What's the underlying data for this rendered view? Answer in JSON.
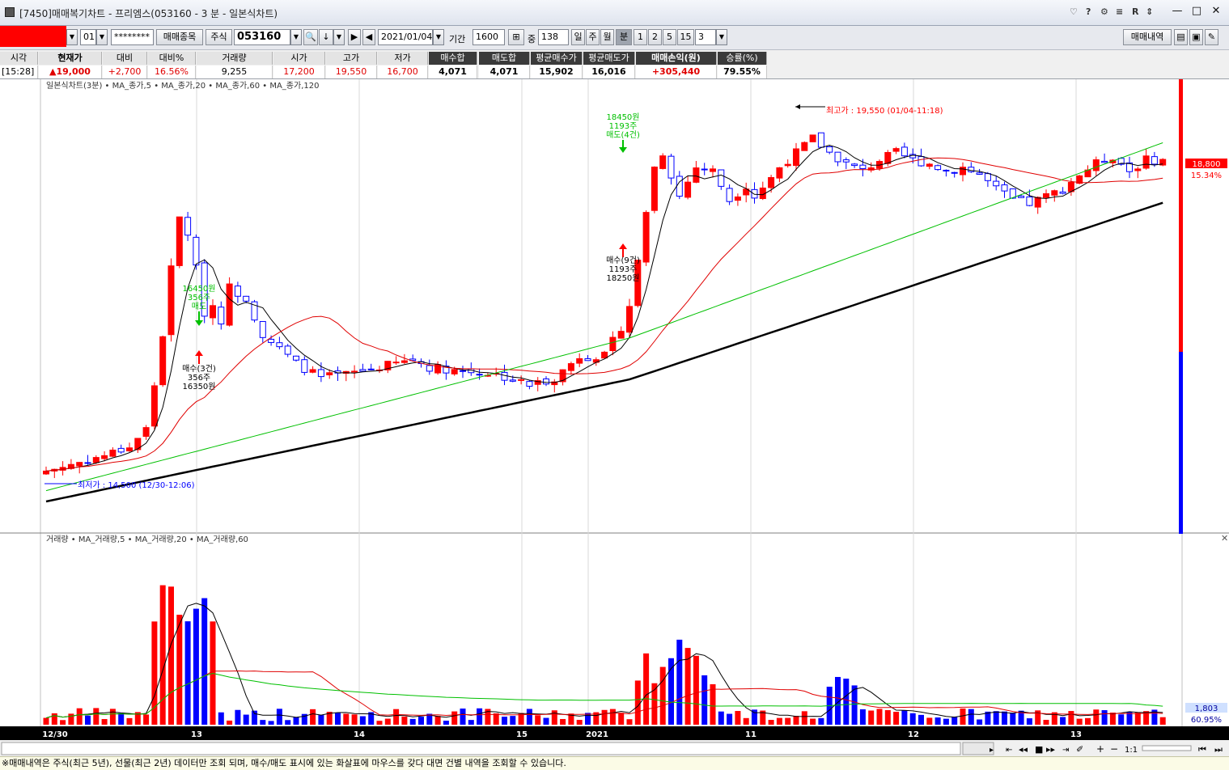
{
  "window": {
    "title": "[7450]매매복기차트 - 프리엠스(053160 - 3 분 - 일본식차트)",
    "controls": [
      "?",
      "R"
    ]
  },
  "toolbar": {
    "account_suffix": "01",
    "password_mask": "********",
    "trade_item_button": "매매종목",
    "market_label": "주식",
    "stock_code": "053160",
    "date": "2021/01/04",
    "period_label": "기간",
    "period_value": "1600",
    "middle_label": "중",
    "middle_value": "138",
    "timeframes": [
      "일",
      "주",
      "월",
      "분",
      "1",
      "2",
      "5",
      "15",
      "3"
    ],
    "selected_timeframe": "분",
    "trade_history_button": "매매내역"
  },
  "info_table": {
    "headers": [
      "시각",
      "현재가",
      "대비",
      "대비%",
      "거래량",
      "시가",
      "고가",
      "저가",
      "매수합",
      "매도합",
      "평균매수가",
      "평균매도가",
      "매매손익(원)",
      "승률(%)"
    ],
    "values": [
      "[15:28]",
      "▲19,000",
      "+2,700",
      "16.56%",
      "9,255",
      "17,200",
      "19,550",
      "16,700",
      "4,071",
      "4,071",
      "15,902",
      "16,016",
      "+305,440",
      "79.55%"
    ]
  },
  "chart_data": {
    "type": "candlestick",
    "price_legend": [
      "일본식차트(3분)",
      "MA_종가,5",
      "MA_종가,20",
      "MA_종가,60",
      "MA_종가,120"
    ],
    "volume_legend": [
      "거래량",
      "MA_거래량,5",
      "MA_거래량,20",
      "MA_거래량,60"
    ],
    "x_labels": [
      "12/30",
      "13",
      "14",
      "15",
      "2021",
      "11",
      "12",
      "13"
    ],
    "annotations": {
      "high": "최고가 : 19,550 (01/04-11:18)",
      "low": "최저가 : 14,500 (12/30-12:06)",
      "sell1": [
        "16450원",
        "356주",
        "매도"
      ],
      "buy1": [
        "매수(3건)",
        "356주",
        "16350원"
      ],
      "sell2": [
        "18450원",
        "1193주",
        "매도(4건)"
      ],
      "buy2": [
        "매수(9건)",
        "1193주",
        "18250원"
      ]
    },
    "price_axis": {
      "current": "18,800",
      "pct": "15.34%"
    },
    "volume_axis": {
      "current": "1,803",
      "pct": "60.95%"
    },
    "ma_colors": {
      "ma5": "#000000",
      "ma20": "#e00000",
      "ma60": "#00c000",
      "ma120": "#000000"
    },
    "up_color": "#ff0000",
    "down_color": "#0000ff"
  },
  "status_bar": {
    "text": "※매매내역은 주식(최근 5년), 선물(최근 2년) 데이터만 조회 되며, 매수/매도 표시에 있는 화살표에 마우스를 갖다 대면 건별 내역을 조회할 수 있습니다."
  },
  "bottom_controls": {
    "zoom_label": "1:1"
  }
}
